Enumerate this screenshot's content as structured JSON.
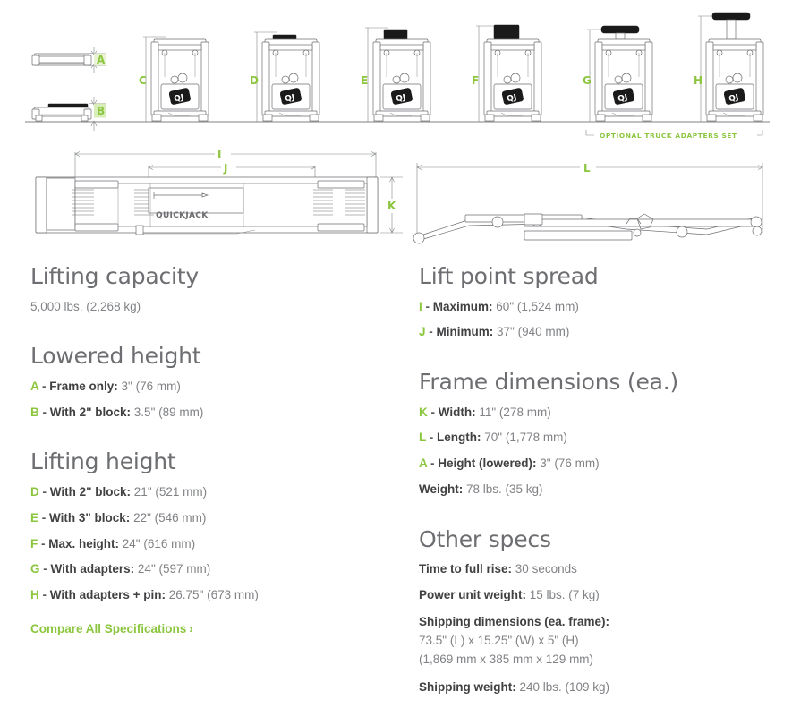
{
  "colors": {
    "accent_green": "#8cc63f",
    "heading_gray": "#6d6e71",
    "body_gray": "#808285",
    "key_gray": "#414042",
    "line_gray": "#6d6e71",
    "background": "#ffffff"
  },
  "diagram": {
    "brand_label": "QUICKJACK",
    "adapters_note": "OPTIONAL TRUCK ADAPTERS SET",
    "height_callouts": [
      "A",
      "B",
      "C",
      "D",
      "E",
      "F",
      "G",
      "H"
    ],
    "plan_callouts": [
      "I",
      "J",
      "K"
    ],
    "side_callout": "L"
  },
  "left_column": {
    "sections": [
      {
        "title": "Lifting capacity",
        "items": [
          {
            "letter": "",
            "key": "",
            "value": "5,000 lbs. (2,268 kg)"
          }
        ]
      },
      {
        "title": "Lowered height",
        "items": [
          {
            "letter": "A",
            "key": "Frame only:",
            "value": "3\" (76 mm)"
          },
          {
            "letter": "B",
            "key": "With 2\" block:",
            "value": "3.5\" (89 mm)"
          }
        ]
      },
      {
        "title": "Lifting height",
        "items": [
          {
            "letter": "D",
            "key": "With 2\" block:",
            "value": "21\" (521 mm)"
          },
          {
            "letter": "E",
            "key": "With 3\" block:",
            "value": "22\" (546 mm)"
          },
          {
            "letter": "F",
            "key": "Max. height:",
            "value": "24\" (616 mm)"
          },
          {
            "letter": "G",
            "key": "With adapters:",
            "value": "24\" (597 mm)"
          },
          {
            "letter": "H",
            "key": "With adapters + pin:",
            "value": "26.75\" (673 mm)"
          }
        ]
      }
    ],
    "compare_link": "Compare All Specifications",
    "compare_chevron": "›"
  },
  "right_column": {
    "sections": [
      {
        "title": "Lift point spread",
        "items": [
          {
            "letter": "I",
            "key": "Maximum:",
            "value": "60\" (1,524 mm)"
          },
          {
            "letter": "J",
            "key": "Minimum:",
            "value": "37\" (940 mm)"
          }
        ]
      },
      {
        "title": "Frame dimensions (ea.)",
        "items": [
          {
            "letter": "K",
            "key": "Width:",
            "value": "11\" (278 mm)"
          },
          {
            "letter": "L",
            "key": "Length:",
            "value": "70\" (1,778 mm)"
          },
          {
            "letter": "A",
            "key": "Height (lowered):",
            "value": "3\" (76 mm)"
          },
          {
            "letter": "",
            "key": "Weight:",
            "value": "78 lbs. (35 kg)"
          }
        ]
      },
      {
        "title": "Other specs",
        "items": [
          {
            "letter": "",
            "key": "Time to full rise:",
            "value": "30 seconds"
          },
          {
            "letter": "",
            "key": "Power unit weight:",
            "value": "15 lbs. (7 kg)"
          }
        ],
        "block": {
          "key": "Shipping dimensions (ea. frame):",
          "line1": "73.5\" (L) x 15.25\" (W) x 5\" (H)",
          "line2": "(1,869 mm x 385 mm x 129 mm)"
        },
        "tail": [
          {
            "letter": "",
            "key": "Shipping weight:",
            "value": "240 lbs. (109 kg)"
          }
        ]
      }
    ]
  }
}
